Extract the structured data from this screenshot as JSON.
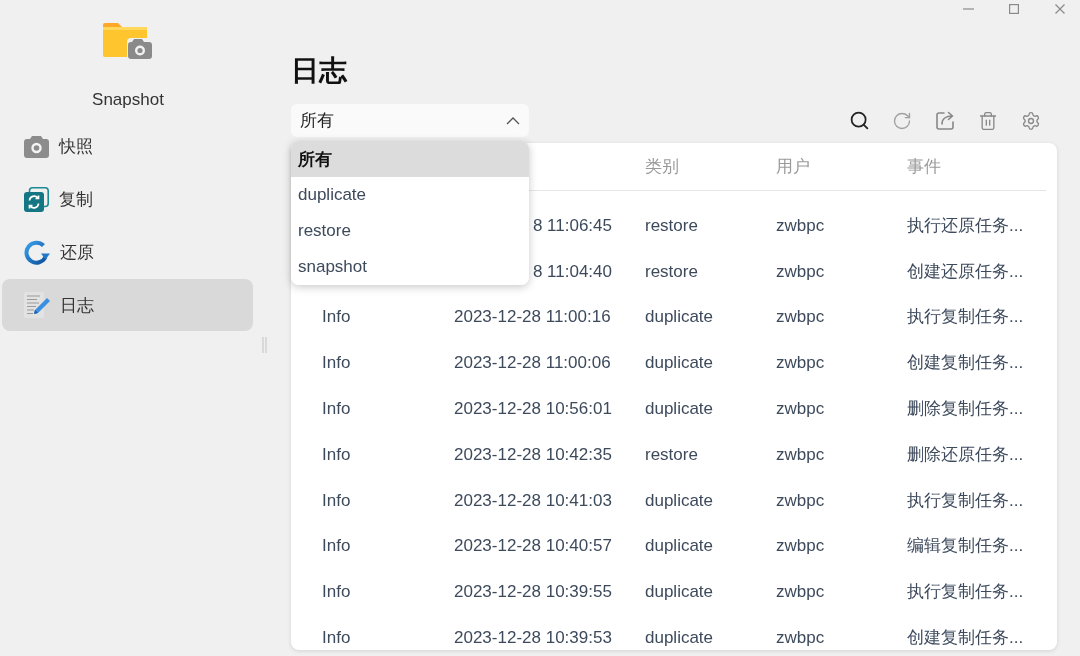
{
  "app": {
    "name": "Snapshot"
  },
  "sidebar": {
    "items": [
      {
        "label": "快照",
        "selected": false
      },
      {
        "label": "复制",
        "selected": false
      },
      {
        "label": "还原",
        "selected": false
      },
      {
        "label": "日志",
        "selected": true
      }
    ]
  },
  "page": {
    "title": "日志"
  },
  "filter": {
    "value": "所有",
    "expanded": true,
    "options": [
      {
        "label": "所有",
        "selected": true
      },
      {
        "label": "duplicate",
        "selected": false
      },
      {
        "label": "restore",
        "selected": false
      },
      {
        "label": "snapshot",
        "selected": false
      }
    ]
  },
  "table": {
    "columns": [
      "类别",
      "用户",
      "事件"
    ],
    "rows": [
      {
        "time": "8 11:06:45",
        "category": "restore",
        "user": "zwbpc",
        "event": "执行还原任务..."
      },
      {
        "time": "8 11:04:40",
        "category": "restore",
        "user": "zwbpc",
        "event": "创建还原任务..."
      },
      {
        "level": "Info",
        "time": "2023-12-28 11:00:16",
        "category": "duplicate",
        "user": "zwbpc",
        "event": "执行复制任务..."
      },
      {
        "level": "Info",
        "time": "2023-12-28 11:00:06",
        "category": "duplicate",
        "user": "zwbpc",
        "event": "创建复制任务..."
      },
      {
        "level": "Info",
        "time": "2023-12-28 10:56:01",
        "category": "duplicate",
        "user": "zwbpc",
        "event": "删除复制任务..."
      },
      {
        "level": "Info",
        "time": "2023-12-28 10:42:35",
        "category": "restore",
        "user": "zwbpc",
        "event": "删除还原任务..."
      },
      {
        "level": "Info",
        "time": "2023-12-28 10:41:03",
        "category": "duplicate",
        "user": "zwbpc",
        "event": "执行复制任务..."
      },
      {
        "level": "Info",
        "time": "2023-12-28 10:40:57",
        "category": "duplicate",
        "user": "zwbpc",
        "event": "编辑复制任务..."
      },
      {
        "level": "Info",
        "time": "2023-12-28 10:39:55",
        "category": "duplicate",
        "user": "zwbpc",
        "event": "执行复制任务..."
      },
      {
        "level": "Info",
        "time": "2023-12-28 10:39:53",
        "category": "duplicate",
        "user": "zwbpc",
        "event": "创建复制任务..."
      }
    ]
  }
}
